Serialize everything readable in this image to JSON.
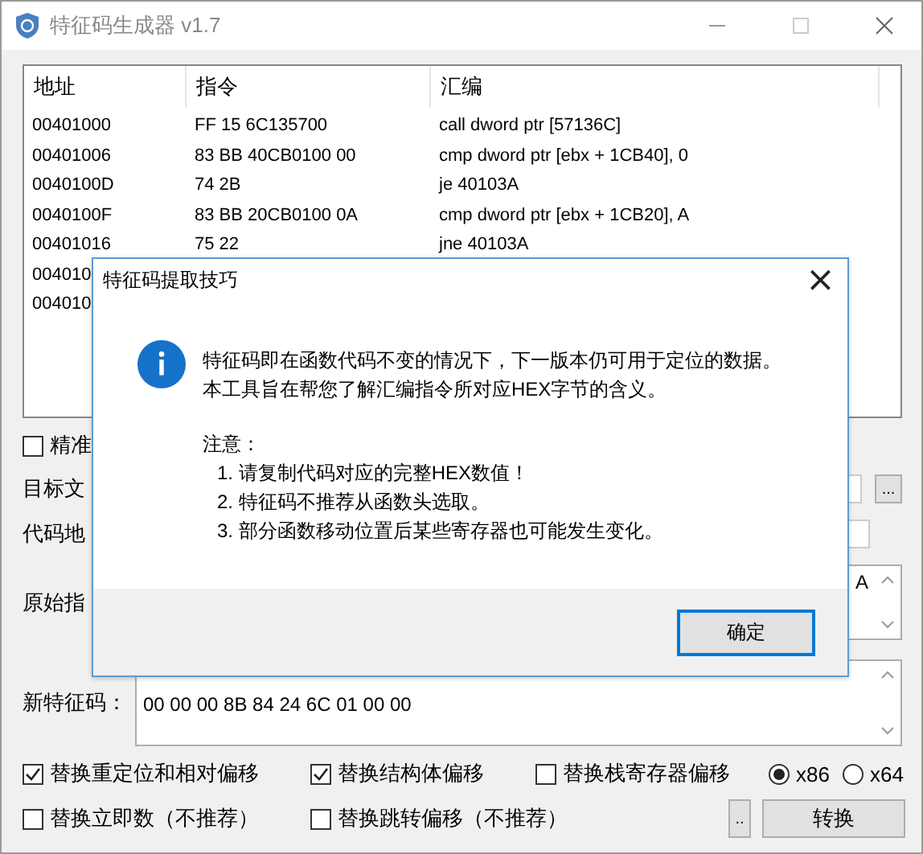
{
  "window": {
    "title": "特征码生成器 v1.7"
  },
  "table": {
    "columns": [
      "地址",
      "指令",
      "汇编"
    ],
    "rows": [
      {
        "address": "00401000",
        "bytes": "FF 15 6C135700",
        "asm": "call dword ptr [57136C]"
      },
      {
        "address": "00401006",
        "bytes": "83 BB 40CB0100 00",
        "asm": "cmp dword ptr [ebx + 1CB40], 0"
      },
      {
        "address": "0040100D",
        "bytes": "74 2B",
        "asm": "je 40103A"
      },
      {
        "address": "0040100F",
        "bytes": "83 BB 20CB0100 0A",
        "asm": "cmp dword ptr [ebx + 1CB20], A"
      },
      {
        "address": "00401016",
        "bytes": "75 22",
        "asm": "jne 40103A"
      },
      {
        "address": "004010"
      },
      {
        "address": "004010"
      }
    ]
  },
  "precise_checkbox": {
    "label": "精准",
    "checked": false
  },
  "target_file": {
    "label": "目标文",
    "browse": "..."
  },
  "code_address": {
    "label": "代码地"
  },
  "original_code": {
    "label": "原始指",
    "visible_text": "A"
  },
  "new_signature": {
    "label": "新特征码：",
    "value": "00 00 00 8B 84 24 6C 01 00 00"
  },
  "options": [
    {
      "label": "替换重定位和相对偏移",
      "checked": true
    },
    {
      "label": "替换结构体偏移",
      "checked": true
    },
    {
      "label": "替换栈寄存器偏移",
      "checked": false
    },
    {
      "label": "替换立即数（不推荐）",
      "checked": false
    },
    {
      "label": "替换跳转偏移（不推荐）",
      "checked": false
    }
  ],
  "arch": [
    {
      "label": "x86",
      "selected": true
    },
    {
      "label": "x64",
      "selected": false
    }
  ],
  "small_button": "..",
  "convert_button": "转换",
  "dialog": {
    "title": "特征码提取技巧",
    "close": "×",
    "lines": [
      "特征码即在函数代码不变的情况下，下一版本仍可用于定位的数据。",
      "本工具旨在帮您了解汇编指令所对应HEX字节的含义。"
    ],
    "note_title": "注意：",
    "notes": [
      "1. 请复制代码对应的完整HEX数值！",
      "2. 特征码不推荐从函数头选取。",
      "3. 部分函数移动位置后某些寄存器也可能发生变化。"
    ],
    "ok": "确定"
  }
}
